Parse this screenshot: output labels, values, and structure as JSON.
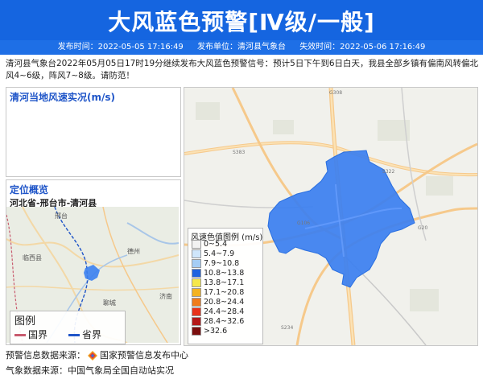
{
  "banner": {
    "title": "大风蓝色预警[Ⅳ级/一般]"
  },
  "meta": {
    "publish_time": "发布时间：2022-05-05 17:16:49",
    "publisher": "发布单位：清河县气象台",
    "expire_time": "失效时间：2022-05-06 17:16:49"
  },
  "description": "清河县气象台2022年05月05日17时19分继续发布大风蓝色预警信号：预计5日下午到6日白天，我县全部乡镇有偏南风转偏北风4~6级，阵风7~8级。请防范！",
  "wind_panel": {
    "title": "清河当地风速实况(m/s)"
  },
  "location_panel": {
    "title": "定位概览",
    "subtitle": "河北省-邢台市-清河县"
  },
  "locator_map": {
    "labels": {
      "left": "临西县",
      "mid": "德州",
      "right": "济南",
      "bottom_left": "聊城",
      "top": "邢台"
    },
    "legend": {
      "title": "图例",
      "items": [
        {
          "label": "国界",
          "color": "#c85a6e"
        },
        {
          "label": "省界",
          "color": "#1f55c8"
        }
      ]
    }
  },
  "main_map": {
    "road_labels": [
      "G308",
      "S383",
      "G106",
      "S322",
      "G20",
      "S234"
    ],
    "warning_color": "#3b7ff0"
  },
  "speed_legend": {
    "title": "风速色值图例 (m/s)",
    "items": [
      {
        "label": "0~5.4",
        "color": "#f2f2f2"
      },
      {
        "label": "5.4~7.9",
        "color": "#cfe6fb"
      },
      {
        "label": "7.9~10.8",
        "color": "#a5cdf5"
      },
      {
        "label": "10.8~13.8",
        "color": "#1f63e0"
      },
      {
        "label": "13.8~17.1",
        "color": "#f6e84a"
      },
      {
        "label": "17.1~20.8",
        "color": "#f4b321"
      },
      {
        "label": "20.8~24.4",
        "color": "#f07c1c"
      },
      {
        "label": "24.4~28.4",
        "color": "#e8331b"
      },
      {
        "label": "28.4~32.6",
        "color": "#b41818"
      },
      {
        "label": ">32.6",
        "color": "#7a0d0d"
      }
    ]
  },
  "footer": {
    "source1_label": "预警信息数据来源：",
    "source1_value": "国家预警信息发布中心",
    "source2": "气象数据来源：中国气象局全国自动站实况"
  }
}
